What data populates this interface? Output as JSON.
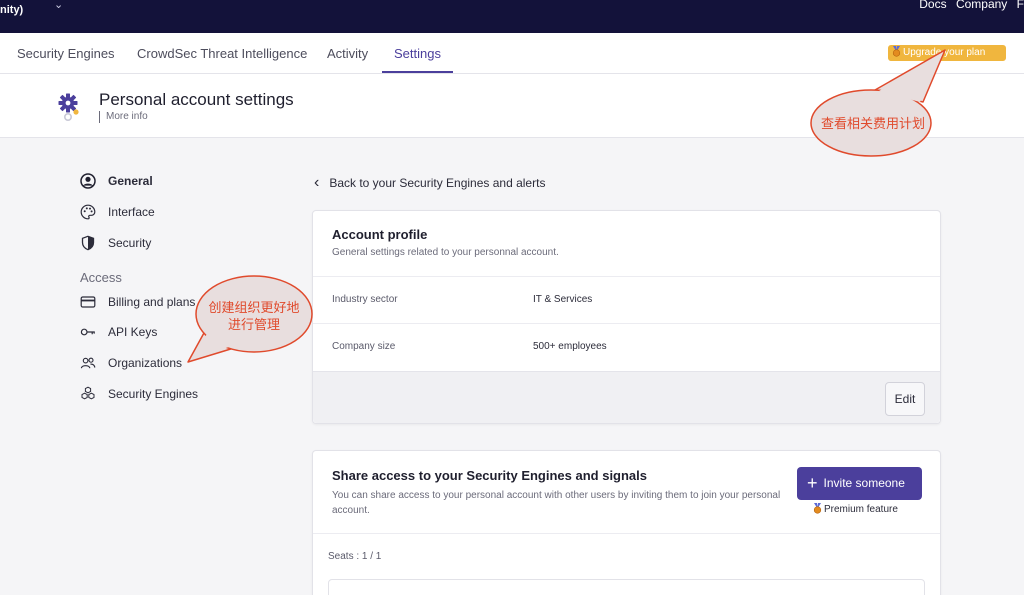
{
  "topbar": {
    "left_text": "nity)",
    "links": [
      "Docs",
      "Company",
      "F"
    ]
  },
  "tabs": [
    {
      "label": "Security Engines"
    },
    {
      "label": "CrowdSec Threat Intelligence"
    },
    {
      "label": "Activity"
    },
    {
      "label": "Settings",
      "active": true
    }
  ],
  "upgrade": {
    "label": "Upgrade your plan"
  },
  "page": {
    "title": "Personal account settings",
    "more_info": "More info"
  },
  "sidebar": {
    "items": [
      {
        "label": "General",
        "icon": "user-circle-icon",
        "active": true
      },
      {
        "label": "Interface",
        "icon": "palette-icon"
      },
      {
        "label": "Security",
        "icon": "shield-icon"
      }
    ],
    "section_label": "Access",
    "access_items": [
      {
        "label": "Billing and plans",
        "icon": "credit-card-icon"
      },
      {
        "label": "API Keys",
        "icon": "key-icon"
      },
      {
        "label": "Organizations",
        "icon": "users-icon"
      },
      {
        "label": "Security Engines",
        "icon": "cubes-icon"
      }
    ]
  },
  "main": {
    "back_label": "Back to your Security Engines and alerts",
    "account_profile": {
      "title": "Account profile",
      "subtitle": "General settings related to your personnal account.",
      "rows": [
        {
          "label": "Industry sector",
          "value": "IT & Services"
        },
        {
          "label": "Company size",
          "value": "500+ employees"
        }
      ],
      "edit_label": "Edit"
    },
    "share": {
      "title": "Share access to your Security Engines and signals",
      "subtitle": "You can share access to your personal account with other users by inviting them to join your personal account.",
      "invite_label": "Invite someone",
      "premium_label": "Premium feature",
      "seats": "Seats : 1 / 1"
    }
  },
  "annotations": {
    "callout_plan": "查看相关费用计划",
    "callout_org_line1": "创建组织更好地",
    "callout_org_line2": "进行管理"
  },
  "colors": {
    "topbar_bg": "#13123a",
    "accent": "#4b3f9c",
    "upgrade_bg": "#f0b63e",
    "callout_border": "#e04a2c",
    "callout_fill": "#e8dede"
  }
}
